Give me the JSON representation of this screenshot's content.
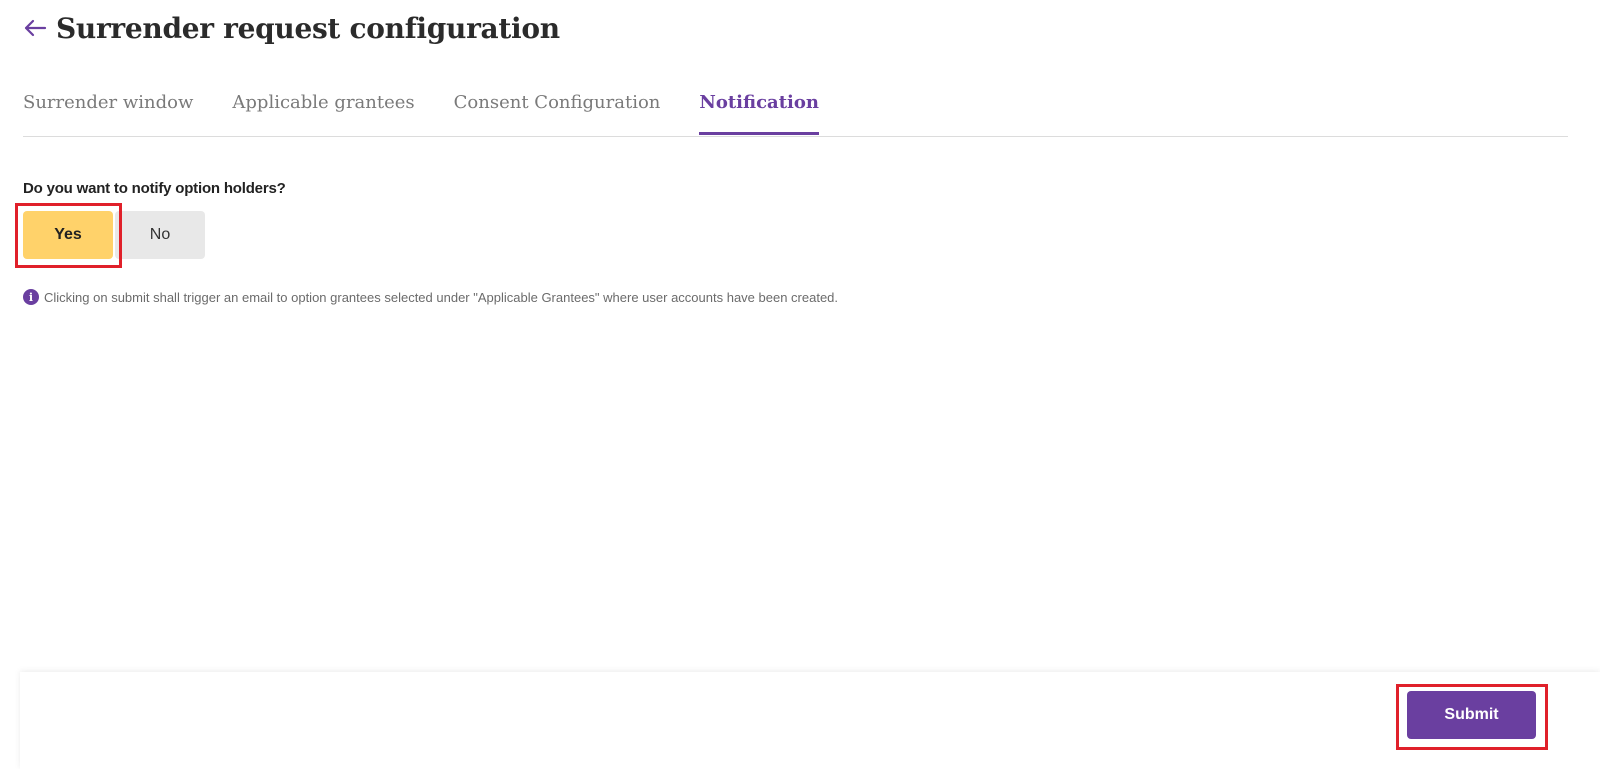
{
  "header": {
    "back_icon": "arrow-left-icon",
    "title": "Surrender request configuration"
  },
  "tabs": [
    {
      "label": "Surrender window",
      "active": false
    },
    {
      "label": "Applicable grantees",
      "active": false
    },
    {
      "label": "Consent Configuration",
      "active": false
    },
    {
      "label": "Notification",
      "active": true
    }
  ],
  "notification": {
    "question": "Do you want to notify option holders?",
    "yes_label": "Yes",
    "no_label": "No",
    "selected": "Yes",
    "info_icon": "info-icon",
    "info_text": "Clicking on submit shall trigger an email to option grantees selected under \"Applicable Grantees\" where user accounts have been created."
  },
  "footer": {
    "submit_label": "Submit"
  },
  "colors": {
    "accent": "#6a3fa0",
    "yes_selected": "#ffd26a",
    "no_unselected": "#e8e8e8",
    "highlight": "#e0202a"
  }
}
